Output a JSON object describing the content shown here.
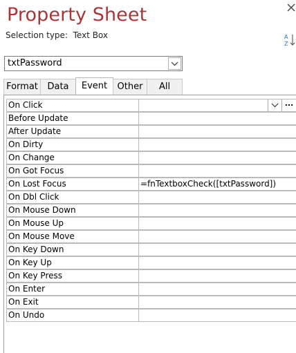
{
  "window": {
    "title": "Property Sheet"
  },
  "selection": {
    "label": "Selection type:",
    "type": "Text Box"
  },
  "object_combo": {
    "value": "txtPassword"
  },
  "tabs": [
    {
      "label": "Format",
      "active": false
    },
    {
      "label": "Data",
      "active": false
    },
    {
      "label": "Event",
      "active": true
    },
    {
      "label": "Other",
      "active": false
    },
    {
      "label": "All",
      "active": false
    }
  ],
  "properties": [
    {
      "name": "On Click",
      "value": ""
    },
    {
      "name": "Before Update",
      "value": ""
    },
    {
      "name": "After Update",
      "value": ""
    },
    {
      "name": "On Dirty",
      "value": ""
    },
    {
      "name": "On Change",
      "value": ""
    },
    {
      "name": "On Got Focus",
      "value": ""
    },
    {
      "name": "On Lost Focus",
      "value": "=fnTextboxCheck([txtPassword])"
    },
    {
      "name": "On Dbl Click",
      "value": ""
    },
    {
      "name": "On Mouse Down",
      "value": ""
    },
    {
      "name": "On Mouse Up",
      "value": ""
    },
    {
      "name": "On Mouse Move",
      "value": ""
    },
    {
      "name": "On Key Down",
      "value": ""
    },
    {
      "name": "On Key Up",
      "value": ""
    },
    {
      "name": "On Key Press",
      "value": ""
    },
    {
      "name": "On Enter",
      "value": ""
    },
    {
      "name": "On Exit",
      "value": ""
    },
    {
      "name": "On Undo",
      "value": ""
    }
  ],
  "icons": {
    "close": "close-icon",
    "sort": "sort-az-icon",
    "dropdown": "chevron-down-icon",
    "builder": "ellipsis-icon"
  },
  "colors": {
    "title": "#a4373a"
  },
  "build_button_label": "..."
}
